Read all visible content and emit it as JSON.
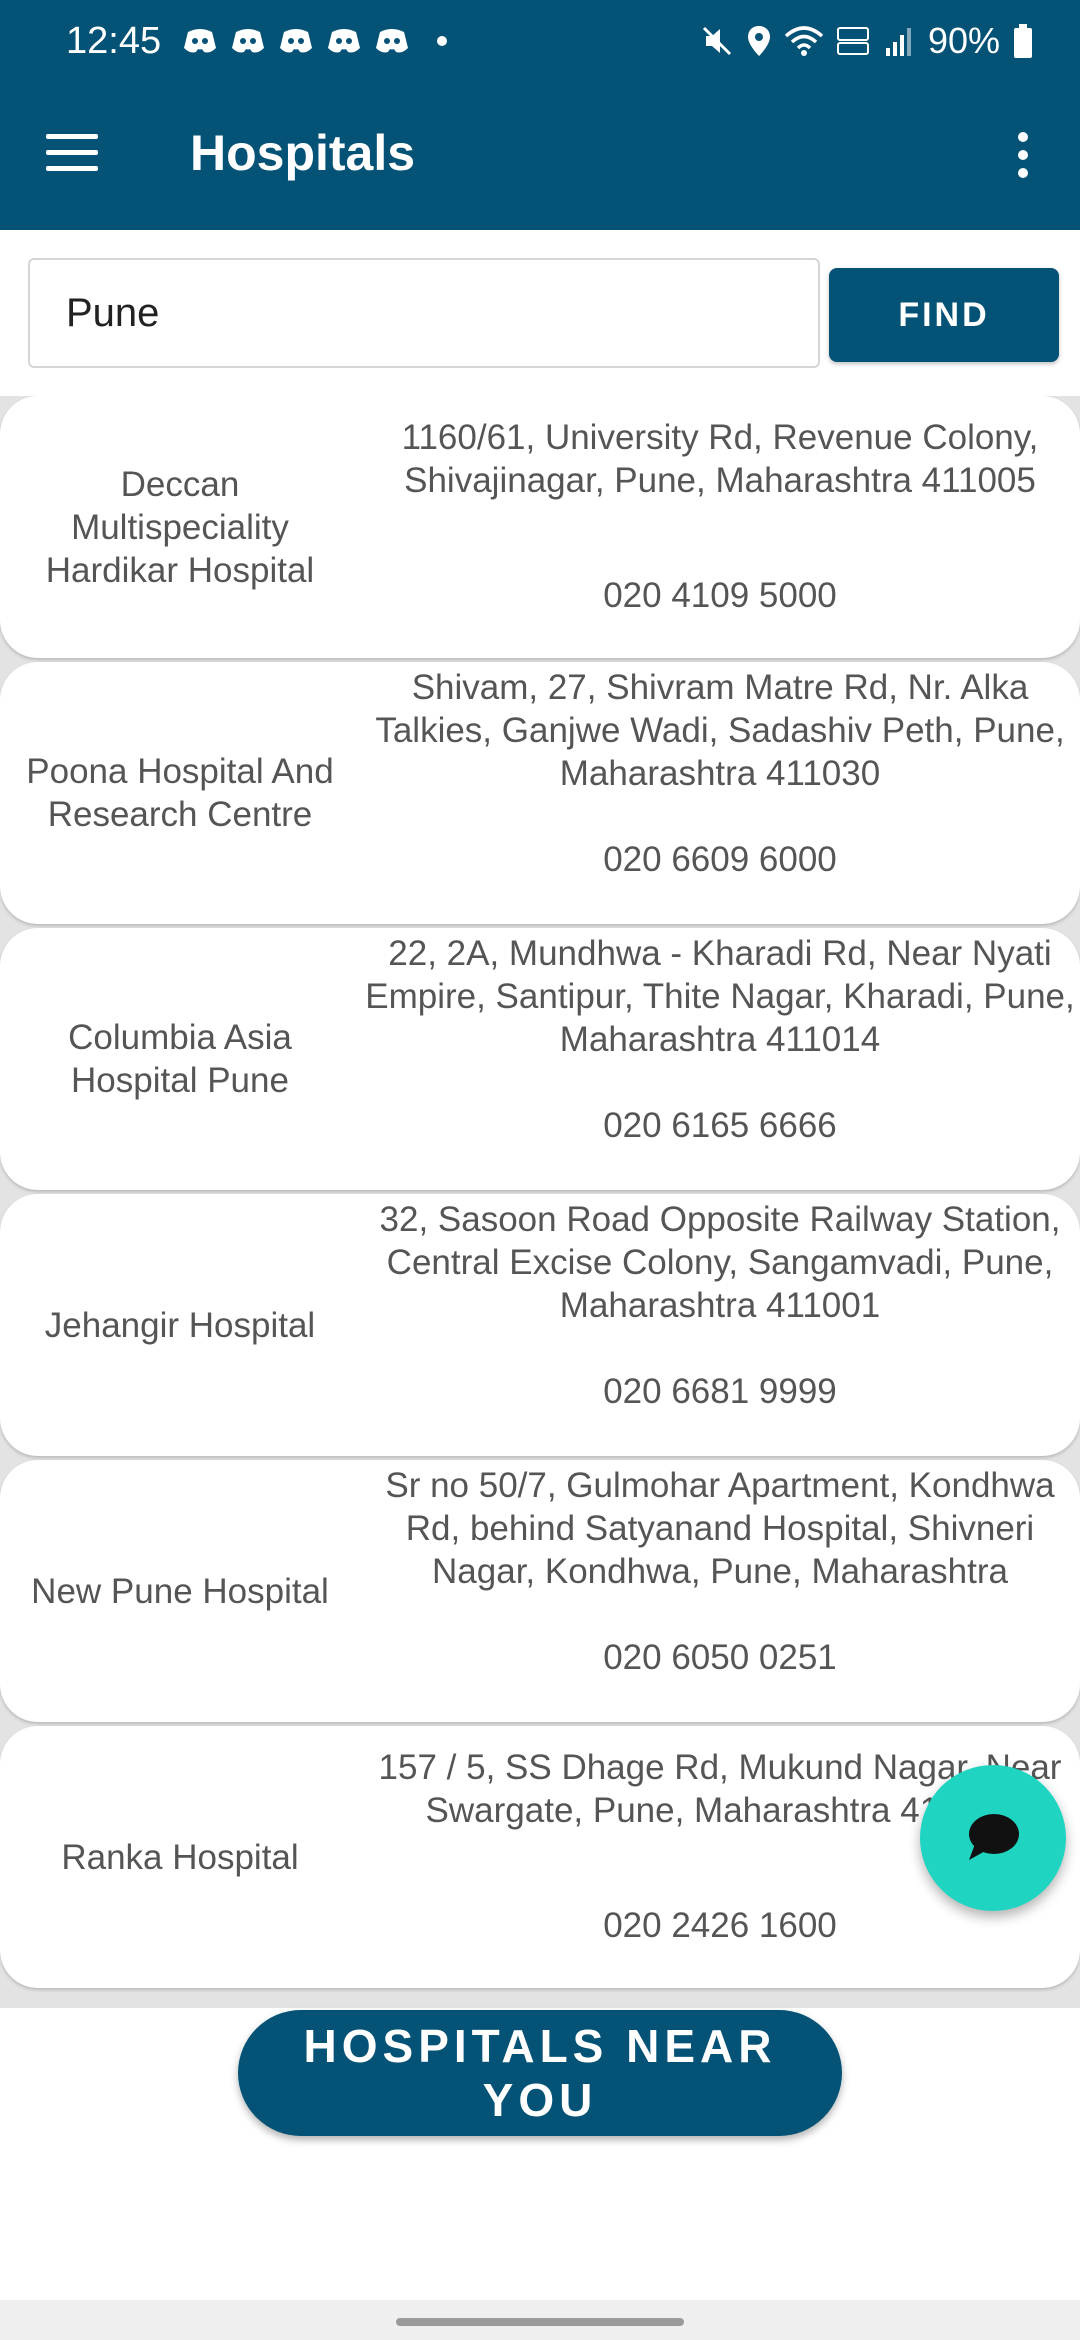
{
  "status_bar": {
    "time": "12:45",
    "battery": "90%",
    "notification_icons": [
      "discord-icon",
      "discord-icon",
      "discord-icon",
      "discord-icon",
      "discord-icon"
    ],
    "system_icons": [
      "mute-icon",
      "location-icon",
      "wifi-icon",
      "volte-icon",
      "signal-icon",
      "battery-icon"
    ]
  },
  "app_bar": {
    "title": "Hospitals",
    "menu_icon": "hamburger-menu-icon",
    "overflow_icon": "more-vert-icon"
  },
  "search": {
    "value": "Pune",
    "button_label": "FIND"
  },
  "hospitals": [
    {
      "name": "Deccan Multispeciality Hardikar Hospital",
      "address": "1160/61, University Rd, Revenue Colony,\nShivajinagar, Pune, Maharashtra 411005",
      "phone": "020 4109 5000"
    },
    {
      "name": "Poona Hospital And Research Centre",
      "address": "Shivam, 27, Shivram Matre Rd, Nr. Alka\nTalkies, Ganjwe Wadi, Sadashiv Peth, Pune,\nMaharashtra 411030",
      "phone": "020 6609 6000"
    },
    {
      "name": "Columbia Asia Hospital Pune",
      "address": "22, 2A, Mundhwa - Kharadi Rd, Near Nyati\nEmpire, Santipur, Thite Nagar, Kharadi, Pune,\nMaharashtra 411014",
      "phone": "020 6165 6666"
    },
    {
      "name": "Jehangir Hospital",
      "address": "32, Sasoon Road Opposite Railway Station,\nCentral Excise Colony, Sangamvadi, Pune,\nMaharashtra 411001",
      "phone": "020 6681 9999"
    },
    {
      "name": "New Pune Hospital",
      "address": "Sr no 50/7, Gulmohar Apartment, Kondhwa\nRd, behind Satyanand Hospital, Shivneri\nNagar, Kondhwa, Pune, Maharashtra",
      "phone": "020 6050 0251"
    },
    {
      "name": "Ranka Hospital",
      "address": "157 / 5, SS Dhage Rd, Mukund Nagar, Near\nSwargate, Pune, Maharashtra 411037",
      "phone": "020 2426 1600"
    }
  ],
  "near_button_label": "HOSPITALS NEAR YOU",
  "chat_fab_icon": "chat-bubble-icon",
  "colors": {
    "primary": "#045377",
    "fab": "#1fd5c2",
    "card_text": "#555555",
    "list_background": "#e3e3e3"
  }
}
